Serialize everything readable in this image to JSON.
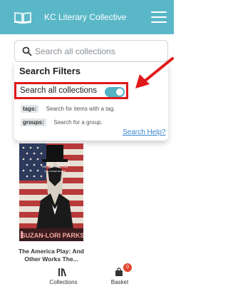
{
  "header": {
    "title": "KC Literary Collective",
    "logo_icon": "open-book-icon",
    "menu_icon": "hamburger-menu-icon",
    "background": "#5ab7c8"
  },
  "search": {
    "placeholder": "Search all collections",
    "value": "",
    "icon": "search-icon"
  },
  "filters": {
    "title": "Search Filters",
    "toggle_label": "Search all collections",
    "toggle_on": true,
    "rows": [
      {
        "tag": "tags:",
        "desc": "Search for items with a tag."
      },
      {
        "tag": "groups:",
        "desc": "Search for a group."
      }
    ],
    "help_link": "Search Help?",
    "highlight_color": "#e0191b"
  },
  "book": {
    "title": "The America Play: And Other Works The...",
    "cover_title": "THE AMERICA PLAY",
    "cover_subtitle": "AND OTHER WORKS",
    "cover_author": "SUZAN-LORI PARKS"
  },
  "bottom_nav": {
    "items": [
      {
        "label": "Collections",
        "icon": "collections-icon"
      },
      {
        "label": "Basket",
        "icon": "basket-icon",
        "badge": "0"
      }
    ]
  }
}
